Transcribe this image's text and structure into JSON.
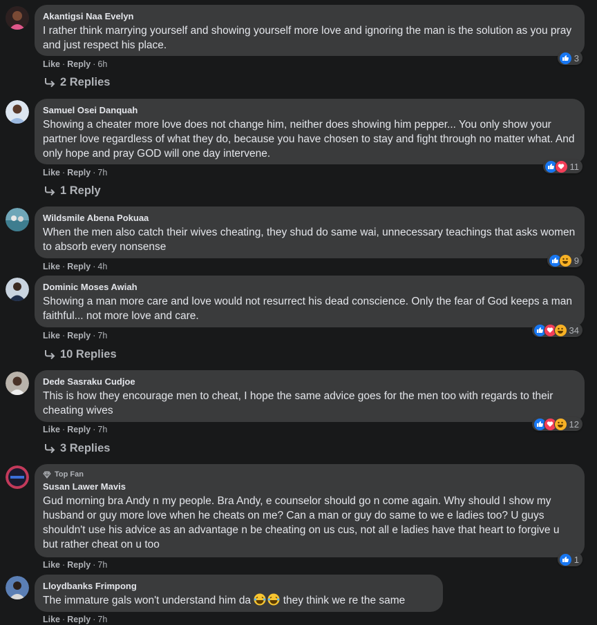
{
  "common": {
    "like": "Like",
    "reply": "Reply",
    "dot": "·"
  },
  "comments": [
    {
      "author": "Akantigsi Naa Evelyn",
      "text": "I rather think marrying yourself and showing yourself more love and ignoring the man is the solution as you pray and just respect his place.",
      "time": "6h",
      "reaction_count": "3",
      "reactions": [
        "like"
      ],
      "replies": "2 Replies"
    },
    {
      "author": "Samuel Osei Danquah",
      "text": "Showing a cheater more love does not change him, neither does showing him pepper... You only show your partner love regardless of what they do, because you have chosen to stay and fight through no matter what. And only hope and pray GOD will one day intervene.",
      "time": "7h",
      "reaction_count": "11",
      "reactions": [
        "like",
        "love"
      ],
      "replies": "1 Reply"
    },
    {
      "author": "Wildsmile Abena Pokuaa",
      "text": "When the men also catch their wives cheating, they shud do same wai, unnecessary teachings that asks women to absorb every nonsense",
      "time": "4h",
      "reaction_count": "9",
      "reactions": [
        "like",
        "haha"
      ]
    },
    {
      "author": "Dominic Moses Awiah",
      "text": "Showing a man more care and love would not resurrect his dead conscience. Only the fear of God keeps a man faithful... not more love and care.",
      "time": "7h",
      "reaction_count": "34",
      "reactions": [
        "like",
        "love",
        "haha"
      ],
      "replies": "10 Replies"
    },
    {
      "author": "Dede Sasraku Cudjoe",
      "text": "This is how they encourage men to cheat, I hope the same advice goes for the men too with regards to their cheating wives",
      "time": "7h",
      "reaction_count": "12",
      "reactions": [
        "like",
        "love",
        "haha"
      ],
      "replies": "3 Replies"
    },
    {
      "badge": "Top Fan",
      "author": "Susan Lawer Mavis",
      "text": "Gud morning bra Andy n my people. Bra Andy, e counselor should go n come again. Why should I show my husband or guy more love when he cheats on me? Can a man or guy do same to we e ladies too? U guys shouldn't use his advice as an advantage n be cheating on us cus, not all e ladies have that heart to forgive u but rather cheat on u too",
      "time": "7h",
      "reaction_count": "1",
      "reactions": [
        "like"
      ]
    },
    {
      "author": "Lloydbanks Frimpong",
      "text_before": "The immature gals won't understand him da",
      "text_after": "they think we re the same",
      "time": "7h"
    }
  ]
}
